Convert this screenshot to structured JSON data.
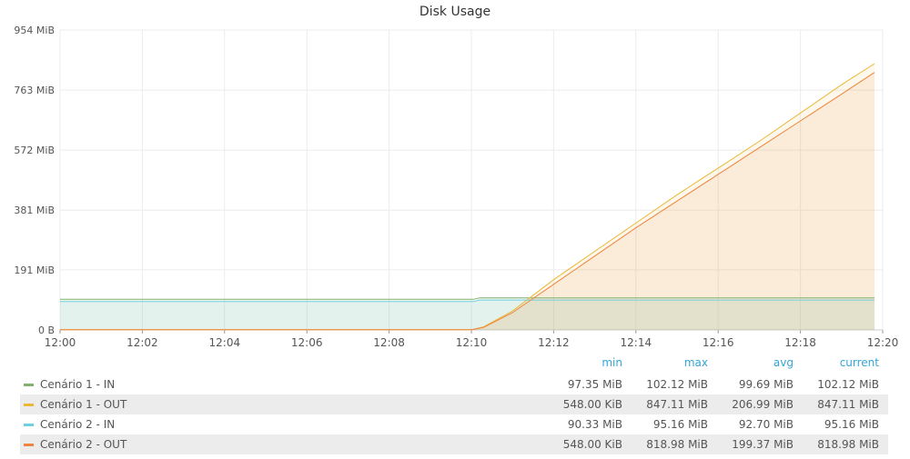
{
  "panel": {
    "title": "Disk Usage"
  },
  "chart_data": {
    "type": "area",
    "title": "Disk Usage",
    "ylabel": "",
    "xlabel": "",
    "ylim_mib": [
      0,
      954
    ],
    "y_ticks": [
      "954 MiB",
      "763 MiB",
      "572 MiB",
      "381 MiB",
      "191 MiB",
      "0 B"
    ],
    "y_tick_values_mib": [
      954,
      763,
      572,
      381,
      191,
      0
    ],
    "x_ticks": [
      "12:00",
      "12:02",
      "12:04",
      "12:06",
      "12:08",
      "12:10",
      "12:12",
      "12:14",
      "12:16",
      "12:18",
      "12:20"
    ],
    "x_tick_minutes": [
      0,
      2,
      4,
      6,
      8,
      10,
      12,
      14,
      16,
      18,
      20
    ],
    "grid": true,
    "legend_position": "bottom",
    "series": [
      {
        "name": "Cenário 1 - IN",
        "color": "#7eb26d",
        "x_minutes": [
          0,
          10.05,
          10.2,
          19.8
        ],
        "values_mib": [
          97.35,
          97.35,
          102.12,
          102.12
        ]
      },
      {
        "name": "Cenário 1 - OUT",
        "color": "#eab839",
        "x_minutes": [
          0,
          10.0,
          10.3,
          11.0,
          12.0,
          13.0,
          14.0,
          15.0,
          16.0,
          17.0,
          18.0,
          19.0,
          19.8
        ],
        "values_mib": [
          0.54,
          0.54,
          10,
          60,
          160,
          250,
          340,
          430,
          515,
          600,
          690,
          780,
          847.11
        ]
      },
      {
        "name": "Cenário 2 - IN",
        "color": "#6ed0e0",
        "x_minutes": [
          0,
          10.05,
          10.2,
          19.8
        ],
        "values_mib": [
          90.33,
          90.33,
          95.16,
          95.16
        ]
      },
      {
        "name": "Cenário 2 - OUT",
        "color": "#ef843c",
        "x_minutes": [
          0,
          10.0,
          10.3,
          11.0,
          12.0,
          13.0,
          14.0,
          15.0,
          16.0,
          17.0,
          18.0,
          19.0,
          19.8
        ],
        "values_mib": [
          0.54,
          0.54,
          8,
          55,
          145,
          235,
          325,
          410,
          495,
          580,
          665,
          750,
          818.98
        ]
      }
    ]
  },
  "legend": {
    "headers": {
      "min": "min",
      "max": "max",
      "avg": "avg",
      "current": "current"
    },
    "rows": [
      {
        "name": "Cenário 1 - IN",
        "color": "#7eb26d",
        "min": "97.35 MiB",
        "max": "102.12 MiB",
        "avg": "99.69 MiB",
        "current": "102.12 MiB"
      },
      {
        "name": "Cenário 1 - OUT",
        "color": "#eab839",
        "min": "548.00 KiB",
        "max": "847.11 MiB",
        "avg": "206.99 MiB",
        "current": "847.11 MiB"
      },
      {
        "name": "Cenário 2 - IN",
        "color": "#6ed0e0",
        "min": "90.33 MiB",
        "max": "95.16 MiB",
        "avg": "92.70 MiB",
        "current": "95.16 MiB"
      },
      {
        "name": "Cenário 2 - OUT",
        "color": "#ef843c",
        "min": "548.00 KiB",
        "max": "818.98 MiB",
        "avg": "199.37 MiB",
        "current": "818.98 MiB"
      }
    ]
  }
}
